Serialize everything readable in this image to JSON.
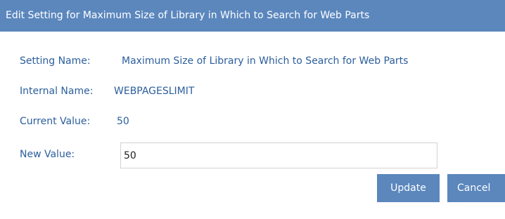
{
  "dialog": {
    "title": "Edit Setting for Maximum Size of Library in Which to Search for Web Parts"
  },
  "fields": {
    "setting_name_label": "Setting Name:",
    "setting_name_value": "Maximum Size of Library in Which to Search for Web Parts",
    "internal_name_label": "Internal Name:",
    "internal_name_value": "WEBPAGESLIMIT",
    "current_value_label": "Current Value:",
    "current_value_value": "50",
    "new_value_label": "New Value:",
    "new_value_input": "50"
  },
  "buttons": {
    "update_label": "Update",
    "cancel_label": "Cancel"
  },
  "colors": {
    "title_bar": "#5b87bd",
    "label_text": "#2b5e9c",
    "button_bg": "#5b87bd"
  }
}
